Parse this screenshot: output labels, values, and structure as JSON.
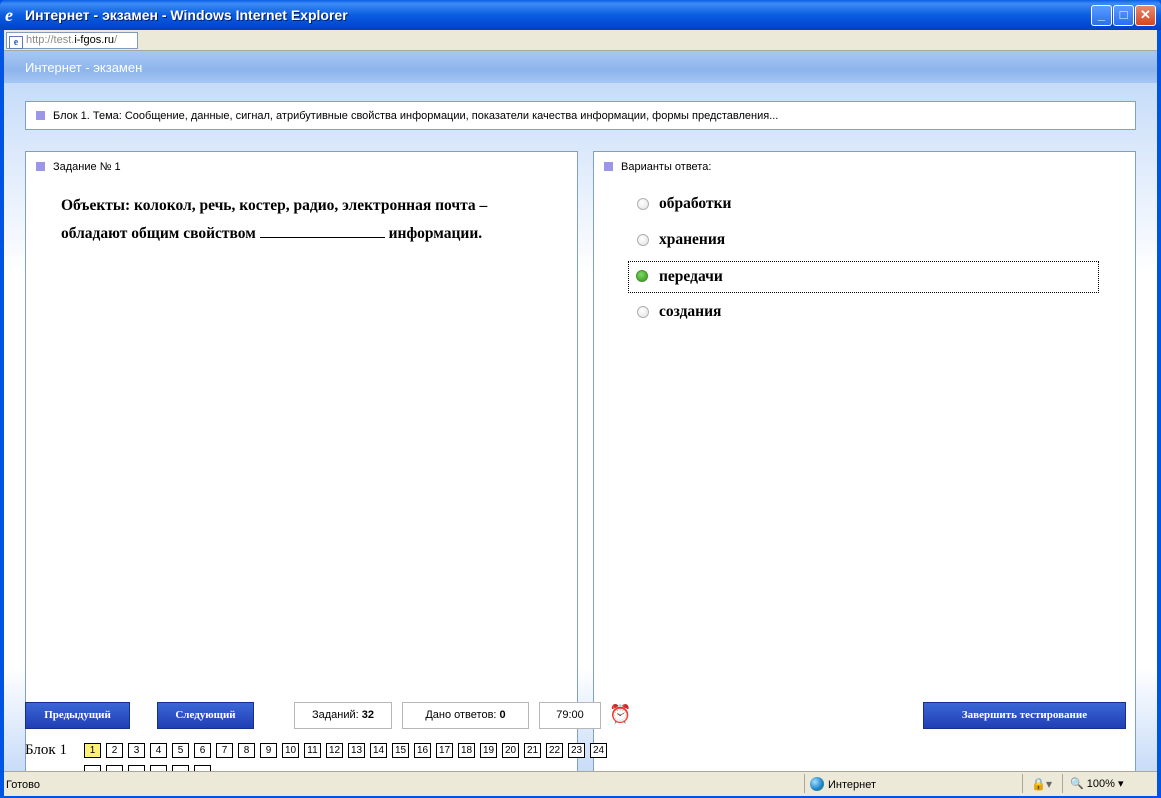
{
  "window": {
    "title": "Интернет - экзамен - Windows Internet Explorer",
    "minimize": "_",
    "maximize": "□",
    "close": "✕"
  },
  "address": {
    "host": "http://test.",
    "domain": "i-fgos.ru",
    "tail": "/"
  },
  "app": {
    "header": "Интернет - экзамен",
    "block_title": "Блок 1. Тема: Сообщение, данные, сигнал, атрибутивные свойства информации, показатели качества информации, формы представления..."
  },
  "task": {
    "label": "Задание № 1",
    "line1": "Объекты: колокол, речь, костер, радио, электронная почта –",
    "line2_before": "обладают общим свойством",
    "line2_after": "информации."
  },
  "answers": {
    "label": "Варианты ответа:",
    "options": [
      {
        "text": "обработки",
        "selected": false
      },
      {
        "text": "хранения",
        "selected": false
      },
      {
        "text": "передачи",
        "selected": true
      },
      {
        "text": "создания",
        "selected": false
      }
    ]
  },
  "controls": {
    "prev": "Предыдущий",
    "next": "Следующий",
    "tasks_label": "Заданий:",
    "tasks_count": "32",
    "answered_label": "Дано ответов:",
    "answered_count": "0",
    "timer": "79:00",
    "finish": "Завершить тестирование"
  },
  "blocks": {
    "block1_label": "Блок 1",
    "block1_questions": [
      "1",
      "2",
      "3",
      "4",
      "5",
      "6",
      "7",
      "8",
      "9",
      "10",
      "11",
      "12",
      "13",
      "14",
      "15",
      "16",
      "17",
      "18",
      "19",
      "20",
      "21",
      "22",
      "23",
      "24"
    ],
    "current": "1"
  },
  "status": {
    "text": "Готово",
    "zone": "Интернет",
    "zoom": "100%"
  },
  "colors": {
    "accent_button": "#1f3fb4",
    "marker": "#9c96e8",
    "selected_radio": "#2c9a12",
    "current_question": "#fff176"
  }
}
